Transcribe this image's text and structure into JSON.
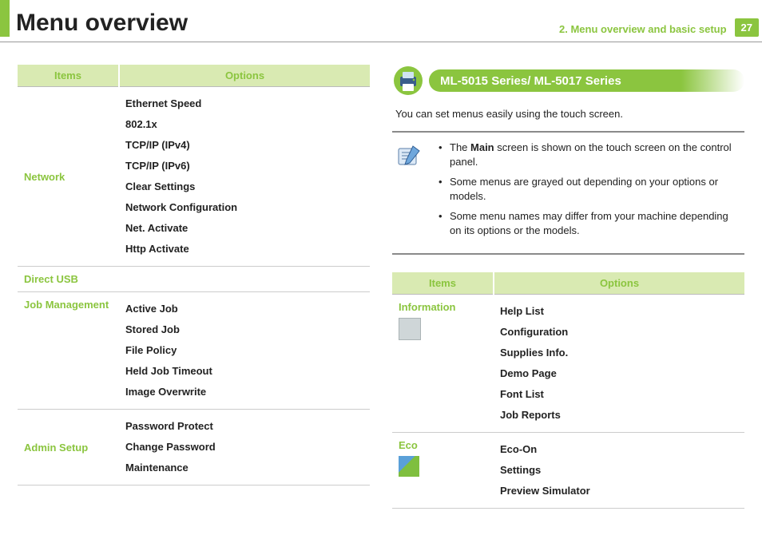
{
  "header": {
    "title": "Menu overview",
    "chapter": "2.  Menu overview and basic setup",
    "page_number": "27"
  },
  "left_table": {
    "header_items": "Items",
    "header_options": "Options",
    "rows": [
      {
        "item": "Network",
        "options": [
          "Ethernet Speed",
          "802.1x",
          "TCP/IP (IPv4)",
          "TCP/IP (IPv6)",
          "Clear Settings",
          "Network Configuration",
          "Net. Activate",
          "Http Activate"
        ]
      },
      {
        "item": "Direct USB",
        "options": []
      },
      {
        "item": "Job Management",
        "options": [
          "Active Job",
          "Stored Job",
          "File Policy",
          "Held Job Timeout",
          "Image Overwrite"
        ]
      },
      {
        "item": "Admin Setup",
        "options": [
          "Password Protect",
          "Change Password",
          "Maintenance"
        ]
      }
    ]
  },
  "right": {
    "series_title": "ML-5015 Series/ ML-5017 Series",
    "intro": "You can set menus easily using the touch screen.",
    "notes": {
      "n1_pre": "The ",
      "n1_bold": "Main",
      "n1_post": " screen is shown on the touch screen on the control panel.",
      "n2": "Some menus are grayed out depending on your options or models.",
      "n3": "Some menu names may differ from your machine depending on its options or the models."
    },
    "table": {
      "header_items": "Items",
      "header_options": "Options",
      "rows": [
        {
          "item": "Information",
          "icon": "device",
          "options": [
            "Help List",
            "Configuration",
            "Supplies Info.",
            "Demo Page",
            "Font List",
            "Job Reports"
          ]
        },
        {
          "item": "Eco",
          "icon": "eco",
          "options": [
            "Eco-On",
            "Settings",
            "Preview Simulator"
          ]
        }
      ]
    }
  }
}
